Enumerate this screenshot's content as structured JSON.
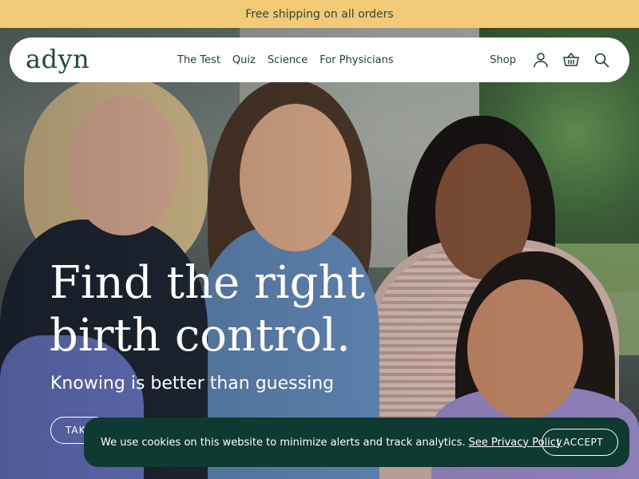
{
  "promo": {
    "text": "Free shipping on all orders"
  },
  "nav": {
    "logo": "adyn",
    "links": [
      "The Test",
      "Quiz",
      "Science",
      "For Physicians"
    ],
    "shop": "Shop",
    "icons": [
      "account-icon",
      "basket-icon",
      "search-icon"
    ]
  },
  "hero": {
    "headline_line1": "Find the right",
    "headline_line2": "birth control.",
    "subhead": "Knowing is better than guessing",
    "cta": "TAKE"
  },
  "cookie": {
    "text": "We use cookies on this website to minimize alerts and track analytics.",
    "link": "See Privacy Policy",
    "accept": "I ACCEPT"
  },
  "colors": {
    "promo_bg": "#f3ca78",
    "brand_green": "#1f4a3d",
    "cookie_bg": "#0f3a32"
  }
}
